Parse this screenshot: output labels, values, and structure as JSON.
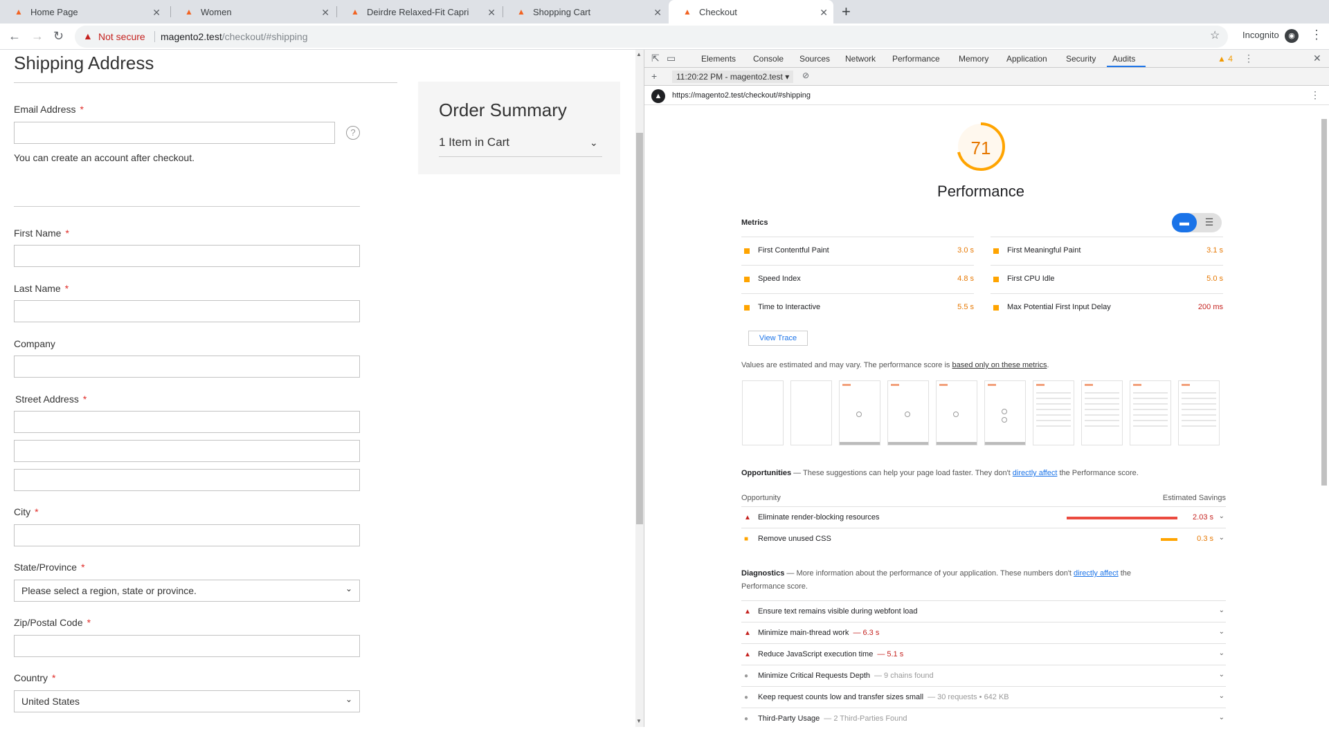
{
  "browser": {
    "tabs": [
      {
        "title": "Home Page"
      },
      {
        "title": "Women"
      },
      {
        "title": "Deirdre Relaxed-Fit Capri"
      },
      {
        "title": "Shopping Cart"
      },
      {
        "title": "Checkout"
      }
    ],
    "not_secure": "Not secure",
    "url_host": "magento2.test",
    "url_path": "/checkout/#shipping",
    "profile": "Incognito"
  },
  "page": {
    "heading": "Shipping Address",
    "email_label": "Email Address",
    "account_note": "You can create an account after checkout.",
    "first_name_label": "First Name",
    "last_name_label": "Last Name",
    "company_label": "Company",
    "street_label": "Street Address",
    "city_label": "City",
    "state_label": "State/Province",
    "state_value": "Please select a region, state or province.",
    "zip_label": "Zip/Postal Code",
    "country_label": "Country",
    "country_value": "United States",
    "req": "*",
    "summary_title": "Order Summary",
    "summary_items": "1 Item in Cart"
  },
  "devtools": {
    "tabs": [
      "Elements",
      "Console",
      "Sources",
      "Network",
      "Performance",
      "Memory",
      "Application",
      "Security",
      "Audits"
    ],
    "warn_count": "4",
    "run": "11:20:22 PM - magento2.test",
    "report_url": "https://magento2.test/checkout/#shipping",
    "score": "71",
    "score_fraction": 0.71,
    "category": "Performance",
    "metrics_heading": "Metrics",
    "metrics": [
      {
        "name": "First Contentful Paint",
        "value": "3.0 s"
      },
      {
        "name": "First Meaningful Paint",
        "value": "3.1 s"
      },
      {
        "name": "Speed Index",
        "value": "4.8 s"
      },
      {
        "name": "First CPU Idle",
        "value": "5.0 s"
      },
      {
        "name": "Time to Interactive",
        "value": "5.5 s"
      },
      {
        "name": "Max Potential First Input Delay",
        "value": "200 ms"
      }
    ],
    "view_trace": "View Trace",
    "est_note": "Values are estimated and may vary. The performance score is ",
    "est_link": "based only on these metrics",
    "opp_title": "Opportunities",
    "opp_desc": " — These suggestions can help your page load faster. They don't ",
    "opp_link": "directly affect",
    "opp_tail": " the Performance score.",
    "opp_col1": "Opportunity",
    "opp_col2": "Estimated Savings",
    "opportunities": [
      {
        "name": "Eliminate render-blocking resources",
        "value": "2.03 s"
      },
      {
        "name": "Remove unused CSS",
        "value": "0.3 s"
      }
    ],
    "diag_title": "Diagnostics",
    "diag_desc": " — More information about the performance of your application. These numbers don't ",
    "diag_link": "directly affect",
    "diag_tail": " the",
    "diag_tail2": "Performance score.",
    "diagnostics": [
      {
        "name": "Ensure text remains visible during webfont load",
        "extra": ""
      },
      {
        "name": "Minimize main-thread work",
        "extra": "— 6.3 s"
      },
      {
        "name": "Reduce JavaScript execution time",
        "extra": "— 5.1 s"
      },
      {
        "name": "Minimize Critical Requests Depth",
        "extra": "— 9 chains found"
      },
      {
        "name": "Keep request counts low and transfer sizes small",
        "extra": "— 30 requests • 642 KB"
      },
      {
        "name": "Third-Party Usage",
        "extra": "— 2 Third-Parties Found"
      }
    ]
  }
}
